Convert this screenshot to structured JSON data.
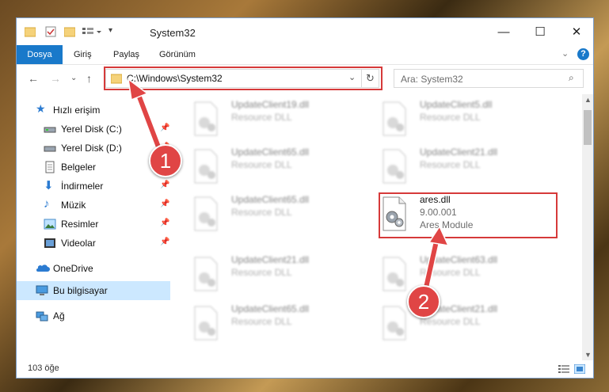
{
  "window": {
    "title": "System32",
    "controls": {
      "minimize": "—",
      "maximize": "☐",
      "close": "✕"
    }
  },
  "ribbon": {
    "tabs": [
      {
        "label": "Dosya"
      },
      {
        "label": "Giriş"
      },
      {
        "label": "Paylaş"
      },
      {
        "label": "Görünüm"
      }
    ]
  },
  "nav": {
    "address_path": "C:\\Windows\\System32",
    "search_placeholder": "Ara: System32"
  },
  "sidebar": {
    "items": [
      {
        "label": "Hızlı erişim",
        "icon": "star-icon"
      },
      {
        "label": "Yerel Disk (C:)",
        "icon": "drive-icon"
      },
      {
        "label": "Yerel Disk (D:)",
        "icon": "drive-icon"
      },
      {
        "label": "Belgeler",
        "icon": "document-icon"
      },
      {
        "label": "İndirmeler",
        "icon": "download-icon"
      },
      {
        "label": "Müzik",
        "icon": "music-icon"
      },
      {
        "label": "Resimler",
        "icon": "pictures-icon"
      },
      {
        "label": "Videolar",
        "icon": "video-icon"
      },
      {
        "label": "OneDrive",
        "icon": "cloud-icon"
      },
      {
        "label": "Bu bilgisayar",
        "icon": "computer-icon"
      },
      {
        "label": "Ağ",
        "icon": "network-icon"
      }
    ]
  },
  "files": [
    {
      "name": "UpdateClient19.dll",
      "type": "Resource DLL"
    },
    {
      "name": "UpdateClient5.dll",
      "type": "Resource DLL"
    },
    {
      "name": "UpdateClient65.dll",
      "type": "Resource DLL"
    },
    {
      "name": "UpdateClient21.dll",
      "type": "Resource DLL"
    },
    {
      "name": "UpdateClient65.dll",
      "type": "Resource DLL"
    },
    {
      "name": "ares.dll",
      "version": "9.00.001",
      "type": "Ares Module"
    },
    {
      "name": "UpdateClient21.dll",
      "type": "Resource DLL"
    },
    {
      "name": "UpdateClient63.dll",
      "type": "Resource DLL"
    },
    {
      "name": "UpdateClient65.dll",
      "type": "Resource DLL"
    },
    {
      "name": "UpdateClient21.dll",
      "type": "Resource DLL"
    }
  ],
  "status": {
    "item_count": "103 öğe"
  },
  "annotations": [
    {
      "label": "1"
    },
    {
      "label": "2"
    }
  ],
  "colors": {
    "accent": "#1979ca",
    "highlight": "#d63a3a",
    "selected": "#cce8ff"
  }
}
